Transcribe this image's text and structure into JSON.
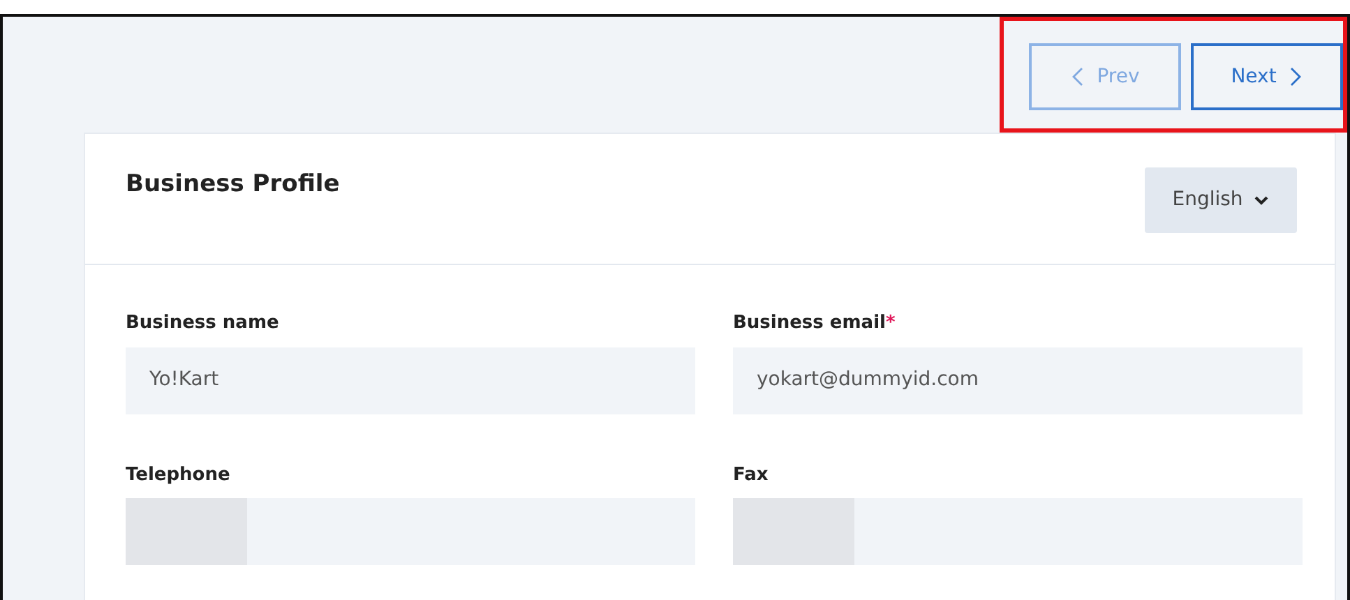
{
  "pager": {
    "highlighted": true,
    "buttons": [
      {
        "kind": "prev",
        "label": "Prev",
        "disabled": true
      },
      {
        "kind": "next",
        "label": "Next",
        "disabled": false
      }
    ]
  },
  "card": {
    "title": "Business Profile",
    "language": "English",
    "fields": [
      {
        "kind": "text",
        "label": "Business name",
        "value": "Yo!Kart"
      },
      {
        "kind": "text",
        "label": "Business email",
        "required_mark": "*",
        "value": "yokart@dummyid.com"
      },
      {
        "kind": "phone",
        "label": "Telephone"
      },
      {
        "kind": "phone",
        "label": "Fax"
      }
    ]
  }
}
